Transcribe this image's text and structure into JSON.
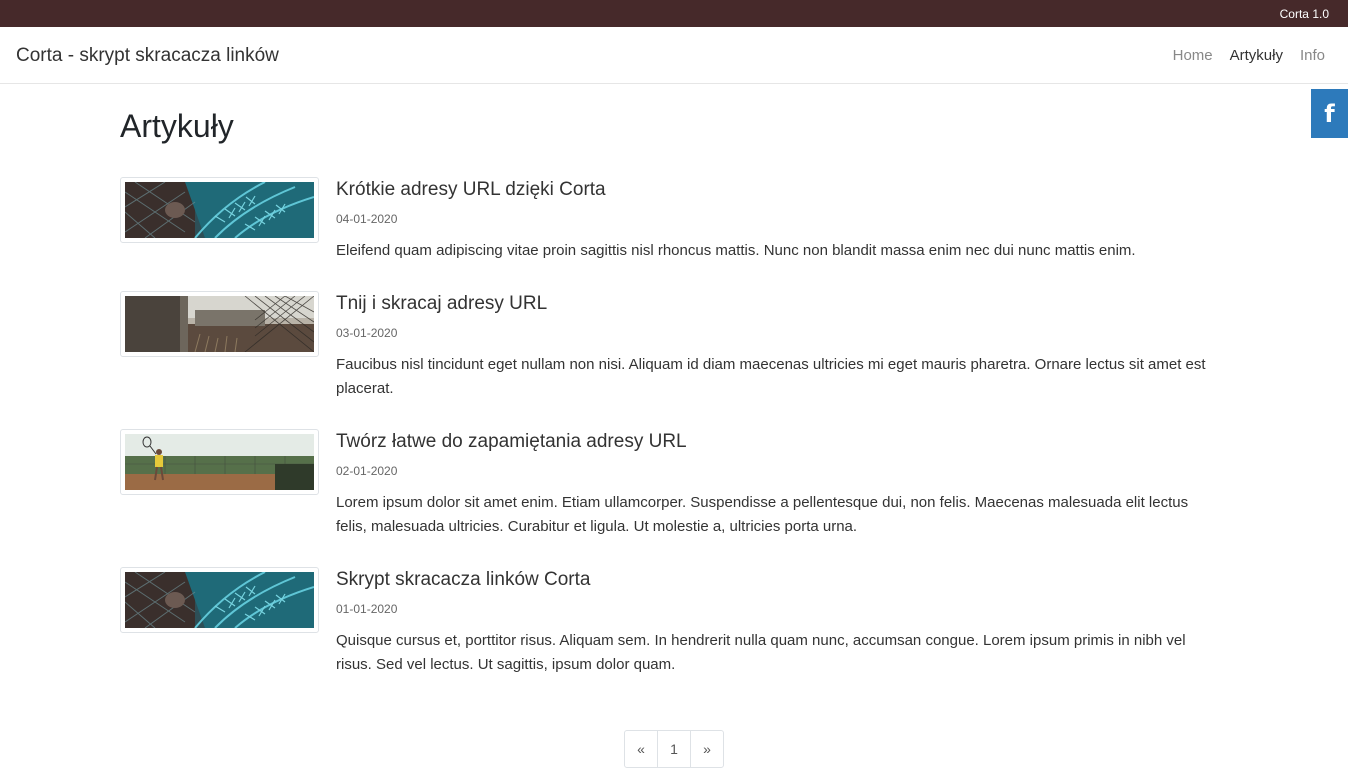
{
  "topbar": {
    "version": "Corta 1.0"
  },
  "navbar": {
    "brand": "Corta - skrypt skracacza linków",
    "links": [
      {
        "label": "Home",
        "active": false
      },
      {
        "label": "Artykuły",
        "active": true
      },
      {
        "label": "Info",
        "active": false
      }
    ]
  },
  "social": {
    "facebook_icon": "facebook-icon",
    "facebook_glyph": "f",
    "color": "#2d7abb"
  },
  "page": {
    "title": "Artykuły"
  },
  "articles": [
    {
      "title": "Krótkie adresy URL dzięki Corta",
      "date": "04-01-2020",
      "excerpt": "Eleifend quam adipiscing vitae proin sagittis nisl rhoncus mattis. Nunc non blandit massa enim nec dui nunc mattis enim.",
      "thumbnail": "fern-fence-photo"
    },
    {
      "title": "Tnij i skracaj adresy URL",
      "date": "03-01-2020",
      "excerpt": "Faucibus nisl tincidunt eget nullam non nisi. Aliquam id diam maecenas ultricies mi eget mauris pharetra. Ornare lectus sit amet est placerat.",
      "thumbnail": "fence-street-photo"
    },
    {
      "title": "Twórz łatwe do zapamiętania adresy URL",
      "date": "02-01-2020",
      "excerpt": "Lorem ipsum dolor sit amet enim. Etiam ullamcorper. Suspendisse a pellentesque dui, non felis. Maecenas malesuada elit lectus felis, malesuada ultricies. Curabitur et ligula. Ut molestie a, ultricies porta urna.",
      "thumbnail": "tennis-court-photo"
    },
    {
      "title": "Skrypt skracacza linków Corta",
      "date": "01-01-2020",
      "excerpt": "Quisque cursus et, porttitor risus. Aliquam sem. In hendrerit nulla quam nunc, accumsan congue. Lorem ipsum primis in nibh vel risus. Sed vel lectus. Ut sagittis, ipsum dolor quam.",
      "thumbnail": "fern-fence-photo"
    }
  ],
  "pagination": {
    "prev": "«",
    "current": "1",
    "next": "»"
  },
  "colors": {
    "topbar": "#46292a",
    "facebook": "#2d7abb"
  }
}
